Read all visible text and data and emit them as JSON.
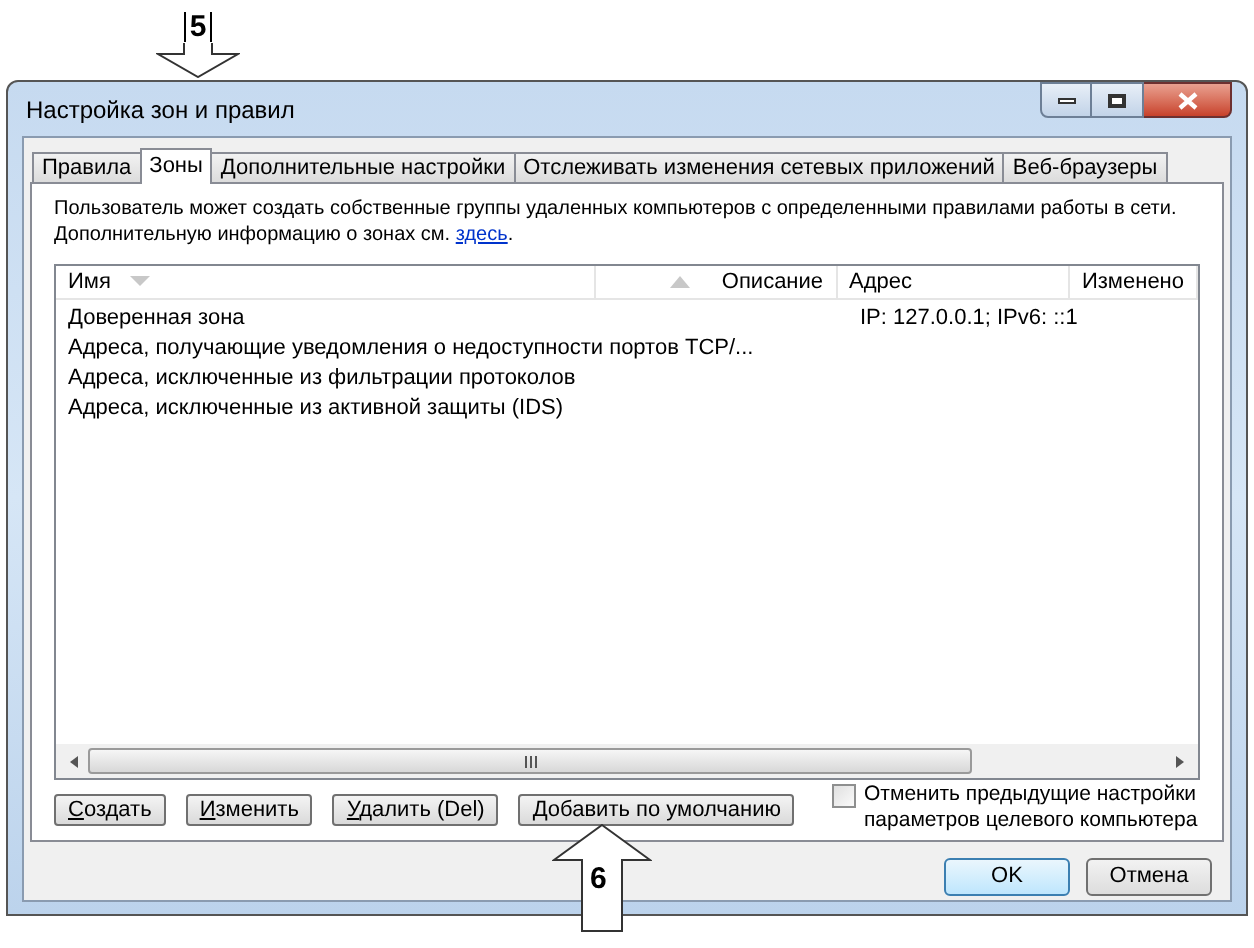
{
  "window": {
    "title": "Настройка зон и правил"
  },
  "tabs": [
    {
      "label": "Правила",
      "selected": false
    },
    {
      "label": "Зоны",
      "selected": true
    },
    {
      "label": "Дополнительные настройки",
      "selected": false
    },
    {
      "label": "Отслеживать изменения сетевых приложений",
      "selected": false
    },
    {
      "label": "Веб-браузеры",
      "selected": false
    }
  ],
  "description": {
    "lines": [
      "Пользователь может создать собственные группы удаленных компьютеров с определенными правилами работы в сети.",
      "Дополнительную информацию о зонах см. "
    ],
    "link": "здесь",
    "after_link": "."
  },
  "table": {
    "columns": [
      {
        "label": "Имя",
        "kind": "sorted"
      },
      {
        "label": "Описание",
        "kind": "reverse"
      },
      {
        "label": "Адрес",
        "kind": "plain"
      },
      {
        "label": "Изменено",
        "kind": "plain"
      }
    ],
    "rows": [
      {
        "name": "Доверенная зона",
        "address": "IP: 127.0.0.1; IPv6: ::1"
      },
      {
        "name": "Адреса, получающие уведомления о недоступности портов TCP/..."
      },
      {
        "name": "Адреса, исключенные из фильтрации протоколов"
      },
      {
        "name": "Адреса, исключенные из активной защиты (IDS)"
      }
    ]
  },
  "actions": [
    "Создать",
    "Изменить",
    "Удалить (Del)",
    "Добавить по умолчанию"
  ],
  "override": {
    "label": "Отменить предыдущие настройки параметров целевого компьютера",
    "checked": false
  },
  "buttons": [
    {
      "label": "OK",
      "default": true
    },
    {
      "label": "Отмена",
      "default": false
    }
  ],
  "callouts": [
    {
      "label": "5",
      "kind": "down"
    },
    {
      "label": "6",
      "kind": "up"
    }
  ]
}
